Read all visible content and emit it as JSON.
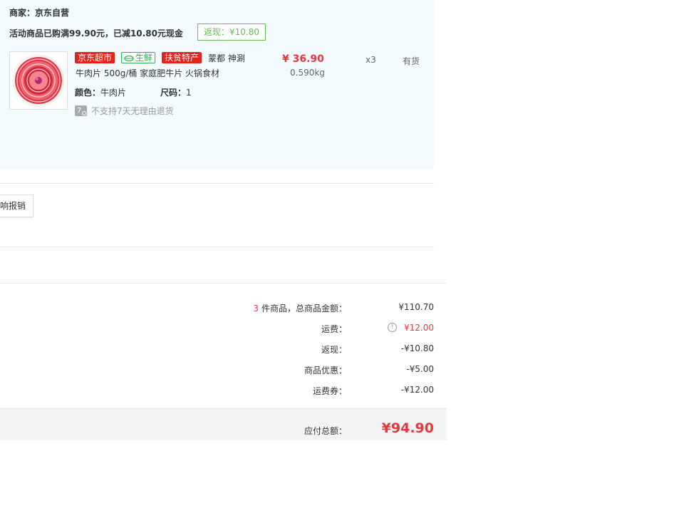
{
  "merchant": {
    "label": "商家：",
    "name": "京东自营"
  },
  "promo": {
    "text": "活动商品已购满99.90元，已减10.80元现金",
    "cashback": "返现：¥10.80"
  },
  "product": {
    "tags": [
      "京东超市",
      "生鲜",
      "扶贫特产"
    ],
    "brand_line": "蒙都 神涮",
    "name": "牛肉片 500g/桶 家庭肥牛片 火锅食材",
    "price": "¥ 36.90",
    "weight": "0.590kg",
    "qty": "x3",
    "stock": "有货",
    "color_label": "颜色：",
    "color_value": "牛肉片",
    "size_label": "尺码：",
    "size_value": "1",
    "return_icon": "7",
    "return_text": "不支持7天无理由退货"
  },
  "invoice_button": "响报销",
  "summary": {
    "count": "3",
    "count_label": "件商品，总商品金额：",
    "goods_total": "¥110.70",
    "freight_label": "运费：",
    "freight_value": "¥12.00",
    "cashback_label": "返现：",
    "cashback_value": "-¥10.80",
    "discount_label": "商品优惠：",
    "discount_value": "-¥5.00",
    "coupon_label": "运费券：",
    "coupon_value": "-¥12.00",
    "total_label": "应付总额：",
    "total_value": "¥94.90"
  },
  "colors": {
    "accent_red": "#e4393c",
    "green": "#2cb352",
    "panel_bg": "#f3fbfe"
  }
}
